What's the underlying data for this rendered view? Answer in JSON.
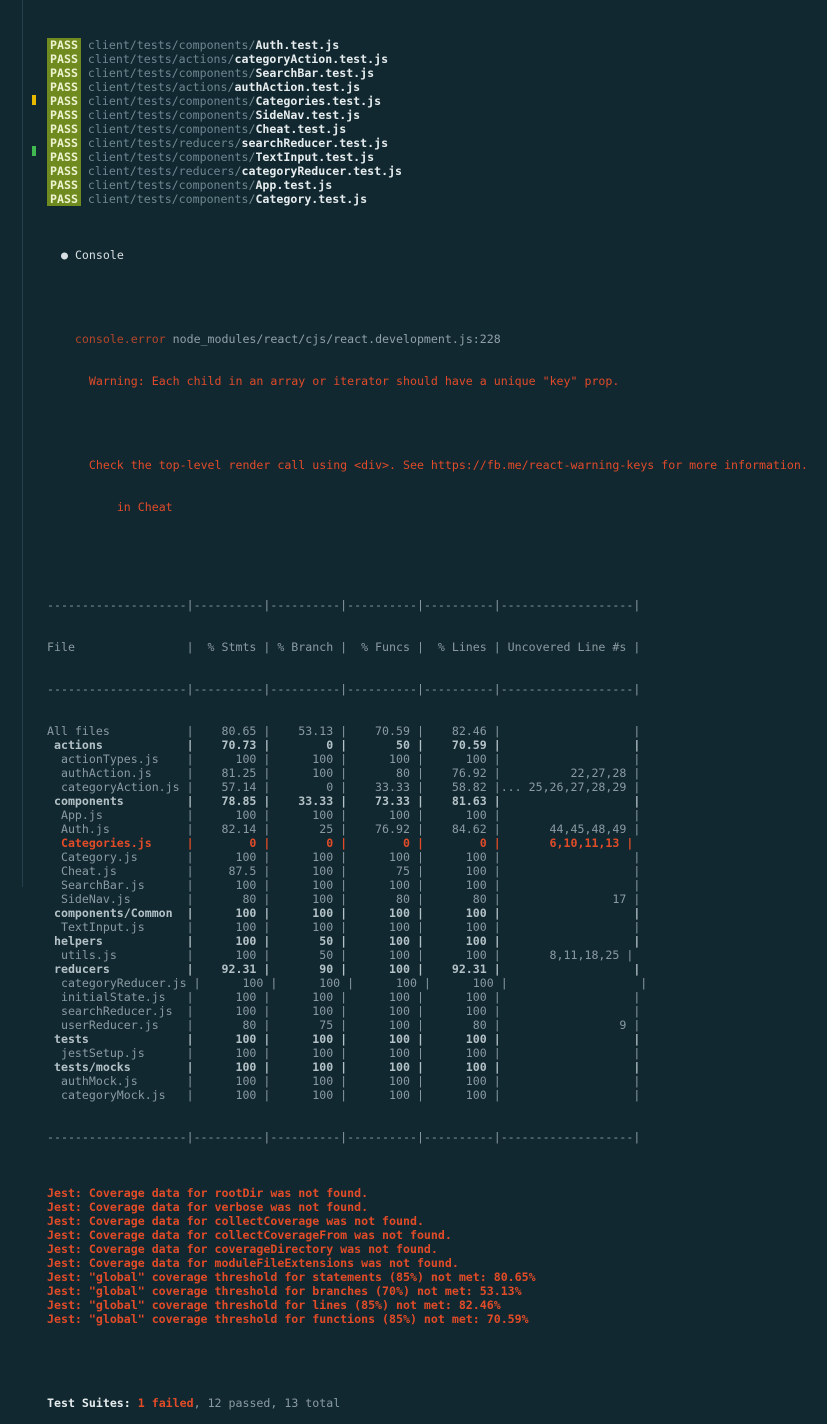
{
  "badge": "PASS",
  "colors": {
    "background": "#112830",
    "pass_badge": "#6f8a1f",
    "error": "#e24b27",
    "marker_yellow": "#e6b800",
    "marker_green": "#3fb950"
  },
  "tests": [
    {
      "dir": "client/tests/components/",
      "file": "Auth.test.js"
    },
    {
      "dir": "client/tests/actions/",
      "file": "categoryAction.test.js"
    },
    {
      "dir": "client/tests/components/",
      "file": "SearchBar.test.js"
    },
    {
      "dir": "client/tests/actions/",
      "file": "authAction.test.js"
    },
    {
      "dir": "client/tests/components/",
      "file": "Categories.test.js"
    },
    {
      "dir": "client/tests/components/",
      "file": "SideNav.test.js"
    },
    {
      "dir": "client/tests/components/",
      "file": "Cheat.test.js"
    },
    {
      "dir": "client/tests/reducers/",
      "file": "searchReducer.test.js"
    },
    {
      "dir": "client/tests/components/",
      "file": "TextInput.test.js"
    },
    {
      "dir": "client/tests/reducers/",
      "file": "categoryReducer.test.js"
    },
    {
      "dir": "client/tests/components/",
      "file": "App.test.js"
    },
    {
      "dir": "client/tests/components/",
      "file": "Category.test.js"
    }
  ],
  "console": {
    "bullet": "●",
    "heading": "Console",
    "error_label": "console.error",
    "error_path": "node_modules/react/cjs/react.development.js:228",
    "warning1": "Warning: Each child in an array or iterator should have a unique \"key\" prop.",
    "warning2": "Check the top-level render call using <div>. See https://fb.me/react-warning-keys for more information.",
    "warning3": "in Cheat"
  },
  "coverage": {
    "separator": "--------------------|----------|----------|----------|----------|-------------------|",
    "header": "File                |  % Stmts | % Branch |  % Funcs |  % Lines | Uncovered Line #s |",
    "rows": [
      {
        "text": "All files           |    80.65 |    53.13 |    70.59 |    82.46 |                   |",
        "style": "gray"
      },
      {
        "text": " actions            |    70.73 |        0 |       50 |    70.59 |                   |",
        "style": "dir"
      },
      {
        "text": "  actionTypes.js    |      100 |      100 |      100 |      100 |                   |",
        "style": "gray"
      },
      {
        "text": "  authAction.js     |    81.25 |      100 |       80 |    76.92 |          22,27,28 |",
        "style": "gray"
      },
      {
        "text": "  categoryAction.js |    57.14 |        0 |    33.33 |    58.82 |... 25,26,27,28,29 |",
        "style": "gray"
      },
      {
        "text": " components         |    78.85 |    33.33 |    73.33 |    81.63 |                   |",
        "style": "dir"
      },
      {
        "text": "  App.js            |      100 |      100 |      100 |      100 |                   |",
        "style": "gray"
      },
      {
        "text": "  Auth.js           |    82.14 |       25 |    76.92 |    84.62 |       44,45,48,49 |",
        "style": "gray"
      },
      {
        "text": "  Categories.js     |        0 |        0 |        0 |        0 |       6,10,11,13 |",
        "style": "redrow"
      },
      {
        "text": "  Category.js       |      100 |      100 |      100 |      100 |                   |",
        "style": "gray"
      },
      {
        "text": "  Cheat.js          |     87.5 |      100 |       75 |      100 |                   |",
        "style": "gray"
      },
      {
        "text": "  SearchBar.js      |      100 |      100 |      100 |      100 |                   |",
        "style": "gray"
      },
      {
        "text": "  SideNav.js        |       80 |      100 |       80 |       80 |                17 |",
        "style": "gray"
      },
      {
        "text": " components/Common  |      100 |      100 |      100 |      100 |                   |",
        "style": "dir"
      },
      {
        "text": "  TextInput.js      |      100 |      100 |      100 |      100 |                   |",
        "style": "gray"
      },
      {
        "text": " helpers            |      100 |       50 |      100 |      100 |                   |",
        "style": "dir"
      },
      {
        "text": "  utils.js          |      100 |       50 |      100 |      100 |       8,11,18,25 |",
        "style": "gray"
      },
      {
        "text": " reducers           |    92.31 |       90 |      100 |    92.31 |                   |",
        "style": "dir"
      },
      {
        "text": "  categoryReducer.js |      100 |      100 |      100 |      100 |                   |",
        "style": "gray"
      },
      {
        "text": "  initialState.js   |      100 |      100 |      100 |      100 |                   |",
        "style": "gray"
      },
      {
        "text": "  searchReducer.js  |      100 |      100 |      100 |      100 |                   |",
        "style": "gray"
      },
      {
        "text": "  userReducer.js    |       80 |       75 |      100 |       80 |                 9 |",
        "style": "gray"
      },
      {
        "text": " tests              |      100 |      100 |      100 |      100 |                   |",
        "style": "dir"
      },
      {
        "text": "  jestSetup.js      |      100 |      100 |      100 |      100 |                   |",
        "style": "gray"
      },
      {
        "text": " tests/mocks        |      100 |      100 |      100 |      100 |                   |",
        "style": "dir"
      },
      {
        "text": "  authMock.js       |      100 |      100 |      100 |      100 |                   |",
        "style": "gray"
      },
      {
        "text": "  categoryMock.js   |      100 |      100 |      100 |      100 |                   |",
        "style": "gray"
      }
    ]
  },
  "jest_messages": [
    "Jest: Coverage data for rootDir was not found.",
    "Jest: Coverage data for verbose was not found.",
    "Jest: Coverage data for collectCoverage was not found.",
    "Jest: Coverage data for collectCoverageFrom was not found.",
    "Jest: Coverage data for coverageDirectory was not found.",
    "Jest: Coverage data for moduleFileExtensions was not found.",
    "Jest: \"global\" coverage threshold for statements (85%) not met: 80.65%",
    "Jest: \"global\" coverage threshold for branches (70%) not met: 53.13%",
    "Jest: \"global\" coverage threshold for lines (85%) not met: 82.46%",
    "Jest: \"global\" coverage threshold for functions (85%) not met: 70.59%"
  ],
  "summary": {
    "label": "Test Suites:",
    "failed": "1 failed",
    "passed": "12 passed",
    "total": "13 total"
  }
}
